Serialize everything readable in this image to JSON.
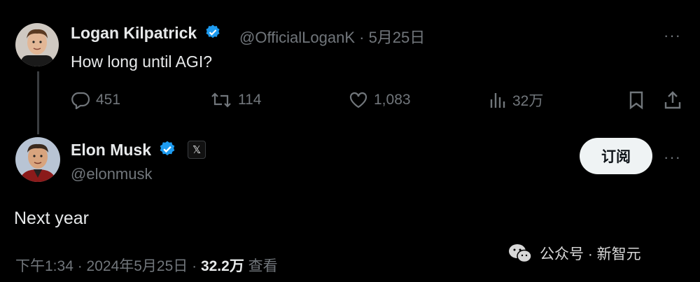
{
  "reply_to": {
    "author_name": "Logan Kilpatrick",
    "handle_date": "@OfficialLoganK · 5月25日",
    "text": "How long until AGI?",
    "stats": {
      "replies": "451",
      "retweets": "114",
      "likes": "1,083",
      "views": "32万"
    }
  },
  "main_tweet": {
    "author_name": "Elon Musk",
    "badge_text": "𝕏",
    "handle": "@elonmusk",
    "subscribe_label": "订阅",
    "text": "Next year",
    "meta": {
      "time_date": "下午1:34 · 2024年5月25日 · ",
      "views_count": "32.2万",
      "views_label": " 查看"
    }
  },
  "watermark": {
    "text": "公众号 · 新智元"
  },
  "more_label": "···",
  "colors": {
    "background": "#000000",
    "text": "#e7e9ea",
    "muted": "#71767b",
    "verified": "#1d9bf0",
    "button_bg": "#eff3f4"
  },
  "icons": [
    "reply-icon",
    "retweet-icon",
    "like-icon",
    "views-icon",
    "bookmark-icon",
    "share-icon",
    "verified-icon",
    "more-icon",
    "wechat-icon"
  ]
}
